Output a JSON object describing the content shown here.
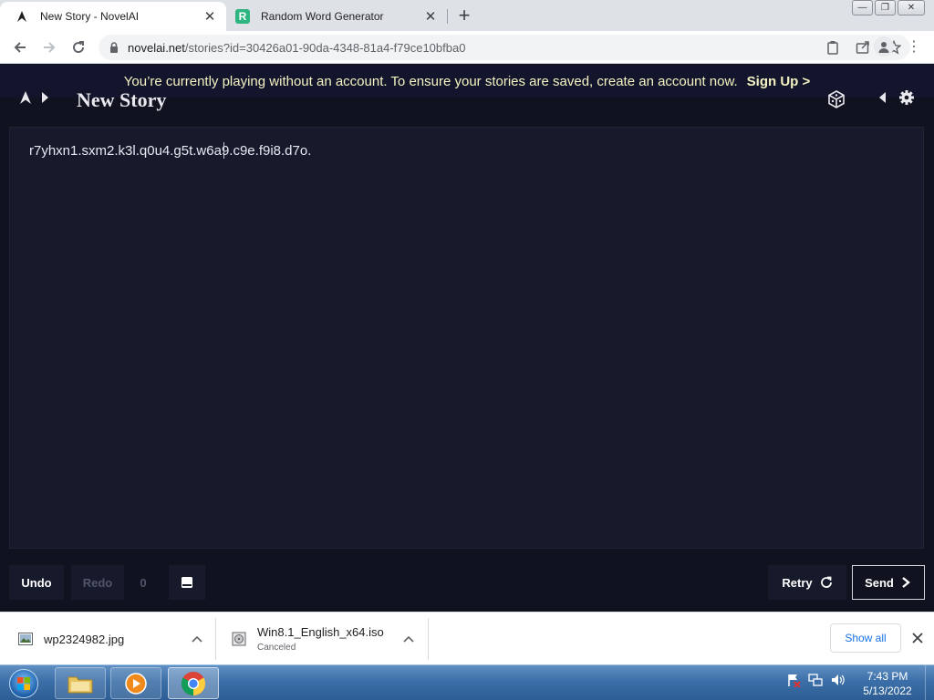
{
  "browser": {
    "tabs": [
      {
        "title": "New Story - NovelAI",
        "icon": "novelai-icon",
        "active": true
      },
      {
        "title": "Random Word Generator",
        "icon": "r-icon",
        "active": false
      }
    ],
    "address": {
      "host": "novelai.net",
      "path": "/stories?id=30426a01-90da-4348-81a4-f79ce10bfba0"
    }
  },
  "app": {
    "banner_text": "You’re currently playing without an account. To ensure your stories are saved, create an account now.",
    "signup_label": "Sign Up >",
    "story_title": "New Story",
    "editor_text": "r7yhxn1.sxm2.k3l.q0u4.g5t.w6a9.c9e.f9i8.d7o.",
    "undo_label": "Undo",
    "redo_label": "Redo",
    "undo_count": "0",
    "retry_label": "Retry",
    "send_label": "Send"
  },
  "downloads": {
    "items": [
      {
        "name": "wp2324982.jpg",
        "status": ""
      },
      {
        "name": "Win8.1_English_x64.iso",
        "status": "Canceled"
      }
    ],
    "show_all_label": "Show all"
  },
  "taskbar": {
    "time": "7:43 PM",
    "date": "5/13/2022"
  },
  "colors": {
    "app_background": "#10121f",
    "editor_background": "#161a2b",
    "banner_text": "#f5f3c2",
    "browser_frame": "#dee1e6"
  }
}
